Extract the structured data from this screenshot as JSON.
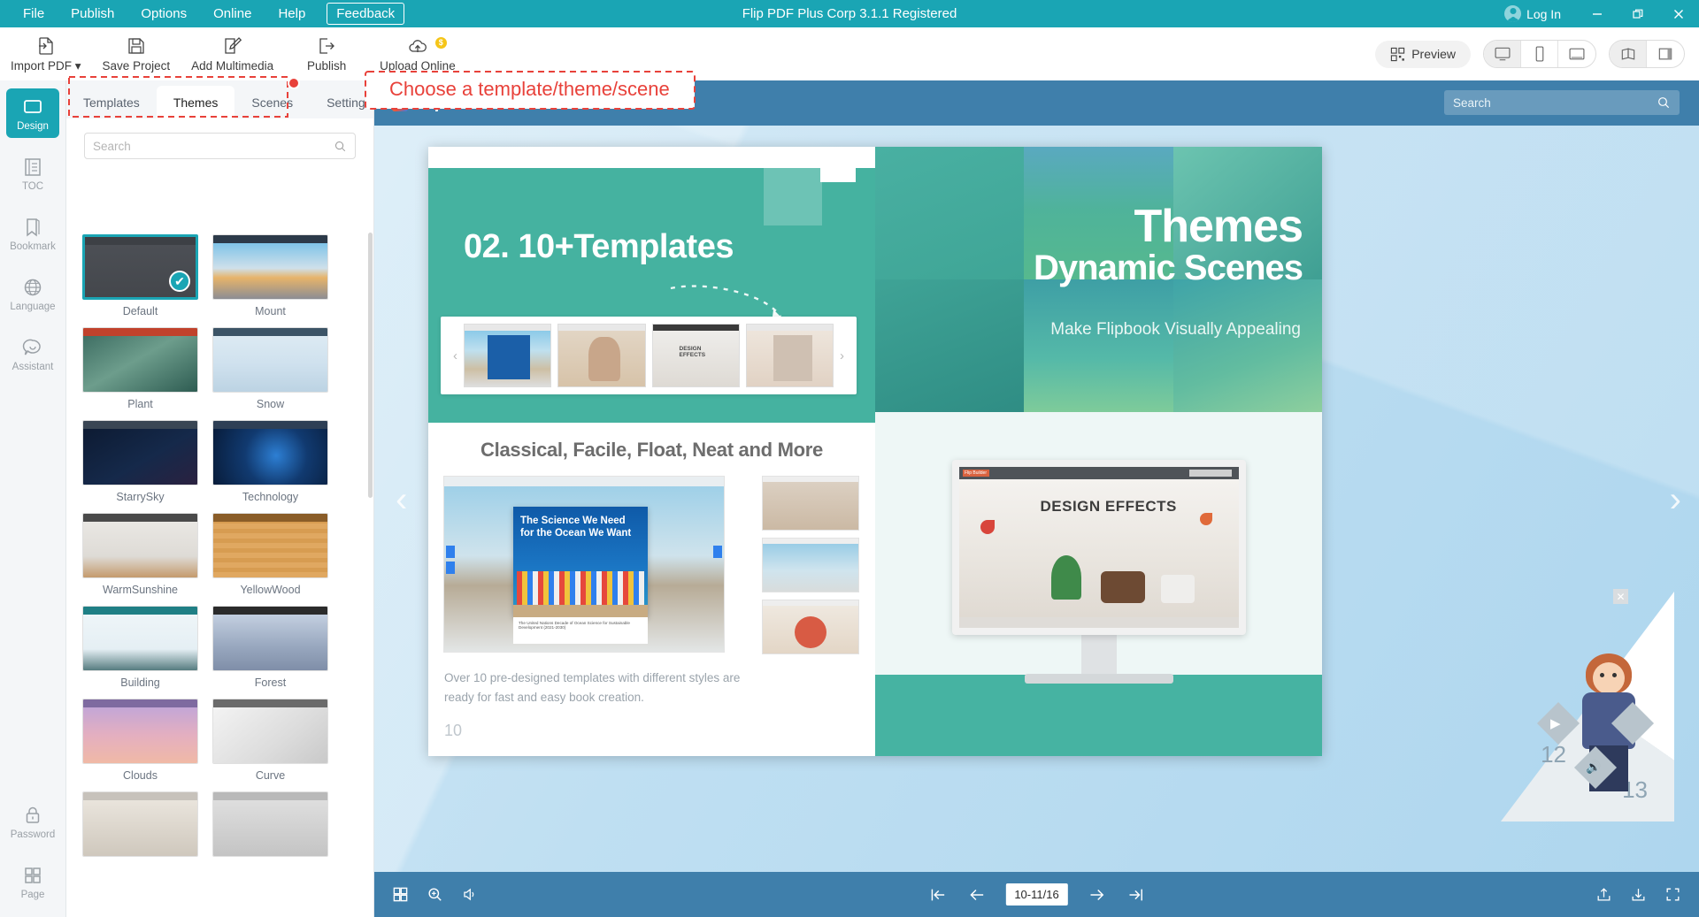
{
  "titlebar": {
    "menus": [
      "File",
      "Publish",
      "Options",
      "Online",
      "Help"
    ],
    "feedback": "Feedback",
    "app_title": "Flip PDF Plus Corp 3.1.1 Registered",
    "login": "Log In",
    "minimize": "–",
    "restore": "❐",
    "close": "✕",
    "accent": "#1aa5b4"
  },
  "ribbon": {
    "items": [
      {
        "label": "Import PDF ▾",
        "icon": "import-pdf-icon"
      },
      {
        "label": "Save Project",
        "icon": "save-icon"
      },
      {
        "label": "Add Multimedia",
        "icon": "edit-icon"
      },
      {
        "label": "Publish",
        "icon": "publish-icon"
      },
      {
        "label": "Upload Online",
        "icon": "cloud-upload-icon",
        "badge": "$"
      }
    ],
    "preview": "Preview",
    "device_modes": [
      "desktop",
      "mobile",
      "tablet"
    ],
    "spread_modes": [
      "double-page",
      "single-page"
    ]
  },
  "annotation": {
    "text": "Choose a template/theme/scene",
    "color": "#e8413a"
  },
  "rail": {
    "items": [
      {
        "label": "Design",
        "icon": "design-icon",
        "active": true
      },
      {
        "label": "TOC",
        "icon": "toc-icon",
        "active": false
      },
      {
        "label": "Bookmark",
        "icon": "bookmark-icon",
        "active": false
      },
      {
        "label": "Language",
        "icon": "globe-icon",
        "active": false
      },
      {
        "label": "Assistant",
        "icon": "chat-smile-icon",
        "active": false
      }
    ],
    "bottom_items": [
      {
        "label": "Password",
        "icon": "lock-icon"
      },
      {
        "label": "Page",
        "icon": "grid-icon"
      }
    ]
  },
  "panel": {
    "tabs": [
      {
        "label": "Templates",
        "active": false
      },
      {
        "label": "Themes",
        "active": true
      },
      {
        "label": "Scenes",
        "active": false
      },
      {
        "label": "Settings",
        "active": false
      }
    ],
    "search_placeholder": "Search",
    "search_value": "",
    "themes": [
      {
        "name": "Default",
        "selected": true,
        "bar": "#3d4045",
        "bg": "linear-gradient(180deg,#4c4f55,#44474c)"
      },
      {
        "name": "Mount",
        "selected": false,
        "bar": "#2c3a49",
        "bg": "linear-gradient(180deg,#7fc3e8 0%,#cfe0ea 45%,#e7b46a 62%,#8c8d93 100%)"
      },
      {
        "name": "Plant",
        "selected": false,
        "bar": "#c1422c",
        "bg": "linear-gradient(150deg,#3f6f64,#6d9d8c 45%,#2e5c52)"
      },
      {
        "name": "Snow",
        "selected": false,
        "bar": "#3c5466",
        "bg": "linear-gradient(180deg,#dceaf3 0%,#cfe1ee 50%,#bcd3e3 100%)"
      },
      {
        "name": "StarrySky",
        "selected": false,
        "bar": "#3a4654",
        "bg": "linear-gradient(150deg,#0d1b33,#15294a 55%,#2a2140)"
      },
      {
        "name": "Technology",
        "selected": false,
        "bar": "#2e3f55",
        "bg": "radial-gradient(circle at 55% 48%, #2d7fd4 0%, #113a70 45%, #081c3a 100%)"
      },
      {
        "name": "WarmSunshine",
        "selected": false,
        "bar": "#4a4a4a",
        "bg": "linear-gradient(180deg,#e9e7e3 0%,#dedbd6 62%,#c49a6d 100%)"
      },
      {
        "name": "YellowWood",
        "selected": false,
        "bar": "#8a5d28",
        "bg": "repeating-linear-gradient(0deg,#e0a861 0 6px,#d79c51 6px 11px)"
      },
      {
        "name": "Building",
        "selected": false,
        "bar": "#1f7f85",
        "bg": "linear-gradient(180deg,#eef5f8 0%,#e5eff4 62%,#567c80 100%)"
      },
      {
        "name": "Forest",
        "selected": false,
        "bar": "#2b2b2b",
        "bg": "linear-gradient(180deg,#c3cfe0 0%,#9aa9c0 55%,#7f8ea8 100%)"
      },
      {
        "name": "Clouds",
        "selected": false,
        "bar": "#7e6aa0",
        "bg": "linear-gradient(180deg,#c3a6d6 0%,#e4afc0 50%,#f0b9a6 100%)"
      },
      {
        "name": "Curve",
        "selected": false,
        "bar": "#6a6a6a",
        "bg": "linear-gradient(140deg,#f3f3f3,#dcdcdc 60%,#c9c9c9)"
      },
      {
        "name": "",
        "selected": false,
        "bar": "#c7c2bb",
        "bg": "linear-gradient(180deg,#e9e4dc,#cfc8bd)"
      },
      {
        "name": "",
        "selected": false,
        "bar": "#b9b9b9",
        "bg": "linear-gradient(180deg,#dedede,#c4c4c4)"
      }
    ]
  },
  "viewer": {
    "logo": "Flip Builder",
    "search_placeholder": "Search",
    "search_value": "",
    "left_page": {
      "title": "02. 10+Templates",
      "subtitle": "Classical, Facile, Float, Neat and More",
      "body": "Over 10 pre-designed templates with different styles are ready for fast and easy book creation.",
      "page_number": "10",
      "cover_title": "The Science We Need for the Ocean We Want",
      "cover_footer": "The United Nations Decade of Ocean Science for Sustainable Development (2021-2030)"
    },
    "right_page": {
      "title_line1": "Themes",
      "title_line2": "Dynamic Scenes",
      "subtitle": "Make Flipbook Visually Appealing",
      "monitor_title": "DESIGN EFFECTS"
    },
    "fold": {
      "left_num": "12",
      "right_num": "13"
    },
    "toolbar": {
      "thumbnails": "thumbnails-icon",
      "zoom": "zoom-icon",
      "sound": "sound-icon",
      "first": "⇤",
      "prev": "←",
      "page_indicator": "10-11/16",
      "next": "→",
      "last": "⇥",
      "share": "share-icon",
      "download": "download-icon",
      "fullscreen": "fullscreen-icon"
    }
  }
}
